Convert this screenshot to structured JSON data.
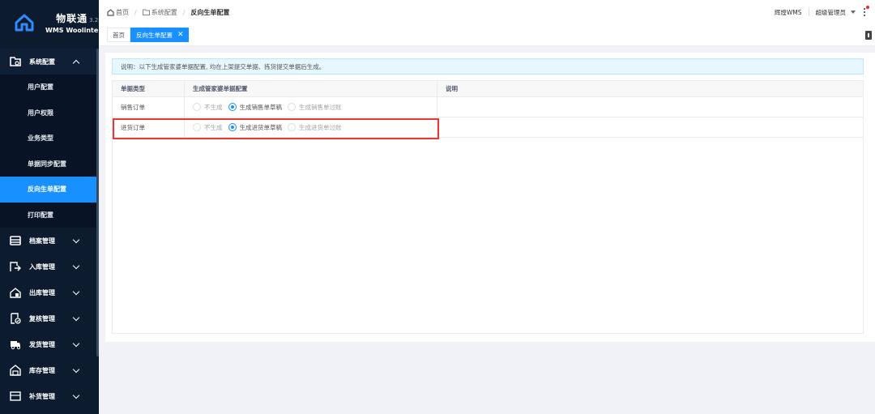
{
  "app": {
    "logo_title": "物联通",
    "logo_version": "3.2",
    "logo_subtitle": "WMS Woolinte"
  },
  "sidebar": {
    "groups": [
      {
        "label": "系统配置",
        "icon": "folder-settings-icon",
        "expanded": true
      },
      {
        "label": "档案管理",
        "icon": "archive-icon"
      },
      {
        "label": "入库管理",
        "icon": "inbound-icon"
      },
      {
        "label": "出库管理",
        "icon": "outbound-icon"
      },
      {
        "label": "复核管理",
        "icon": "review-icon"
      },
      {
        "label": "发货管理",
        "icon": "truck-icon"
      },
      {
        "label": "库存管理",
        "icon": "warehouse-icon"
      },
      {
        "label": "补货管理",
        "icon": "replenish-icon"
      }
    ],
    "submenu": [
      {
        "label": "用户配置"
      },
      {
        "label": "用户权限"
      },
      {
        "label": "业务类型"
      },
      {
        "label": "单据同步配置"
      },
      {
        "label": "反向生单配置",
        "active": true
      },
      {
        "label": "打印配置"
      }
    ]
  },
  "header": {
    "breadcrumb": [
      "首页",
      "系统配置",
      "反向生单配置"
    ],
    "system_name": "辉煌WMS",
    "user_name": "超级管理员"
  },
  "tags": {
    "home": "首页",
    "active": "反向生单配置"
  },
  "notice": "说明：以下生成管家婆单据配置, 均在上架提交单据、拣货提交单据后生成。",
  "table": {
    "headers": [
      "单据类型",
      "生成管家婆单据配置",
      "说明"
    ],
    "rows": [
      {
        "type": "销售订单",
        "options": [
          "不生成",
          "生成销售单草稿",
          "生成销售单过账"
        ],
        "selected": 1,
        "note": ""
      },
      {
        "type": "进货订单",
        "options": [
          "不生成",
          "生成进货单草稿",
          "生成进货单过账"
        ],
        "selected": 1,
        "note": ""
      }
    ]
  },
  "colors": {
    "sidebar_bg": "#0d1b2e",
    "accent": "#1890ff",
    "highlight": "#e53935"
  }
}
